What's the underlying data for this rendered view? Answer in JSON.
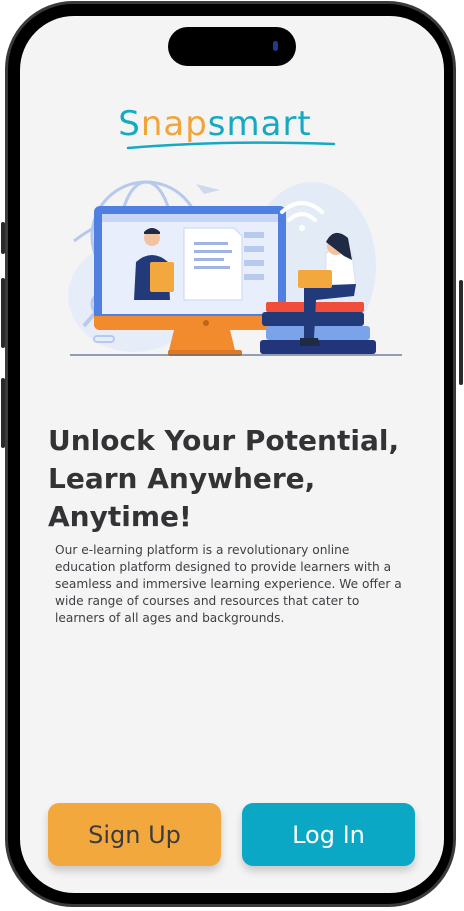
{
  "app": {
    "logo_part1": "S",
    "logo_part2": "nap",
    "logo_part3": "smart"
  },
  "main": {
    "headline": "Unlock Your Potential,\nLearn Anywhere,\nAnytime!",
    "description": "Our e-learning platform is a revolutionary online education platform designed to provide learners with a seamless and immersive learning experience. We offer a wide range of courses and resources that cater to learners of all ages and backgrounds."
  },
  "actions": {
    "signup_label": "Sign Up",
    "login_label": "Log In"
  },
  "colors": {
    "brand_teal": "#0aa8c4",
    "brand_orange": "#f3a83e",
    "background": "#f4f4f5",
    "text_dark": "#333336"
  },
  "icons": [
    "hero-illustration",
    "logo-swoosh"
  ]
}
